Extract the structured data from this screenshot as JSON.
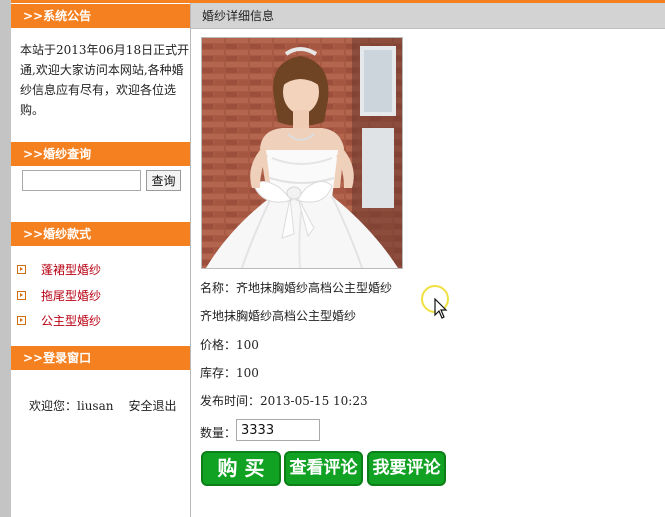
{
  "sidebar": {
    "notice": {
      "title": ">>系统公告",
      "text": "本站于2013年06月18日正式开通,欢迎大家访问本网站,各种婚纱信息应有尽有，欢迎各位选购。"
    },
    "search": {
      "title": ">>婚纱查询",
      "input_value": "",
      "button_label": "查询"
    },
    "styles": {
      "title": ">>婚纱款式",
      "items": [
        {
          "label": "蓬裙型婚纱"
        },
        {
          "label": "拖尾型婚纱"
        },
        {
          "label": "公主型婚纱"
        }
      ]
    },
    "login": {
      "title": ">>登录窗口",
      "welcome_label": "欢迎您：",
      "username": "liusan",
      "logout_label": "安全退出"
    }
  },
  "main": {
    "title": "婚纱详细信息",
    "name_label": "名称：",
    "name_value": "齐地抹胸婚纱高档公主型婚纱",
    "description": "齐地抹胸婚纱高档公主型婚纱",
    "price_label": "价格：",
    "price_value": "100",
    "stock_label": "库存：",
    "stock_value": "100",
    "publish_label": "发布时间：",
    "publish_value": "2013-05-15 10:23",
    "quantity_label": "数量：",
    "quantity_value": "3333",
    "buy_button": "购 买",
    "view_comments_button": "查看评论",
    "write_comment_button": "我要评论"
  },
  "colors": {
    "accent_orange": "#f58020",
    "button_green": "#11a223",
    "link_red": "#b80012"
  }
}
